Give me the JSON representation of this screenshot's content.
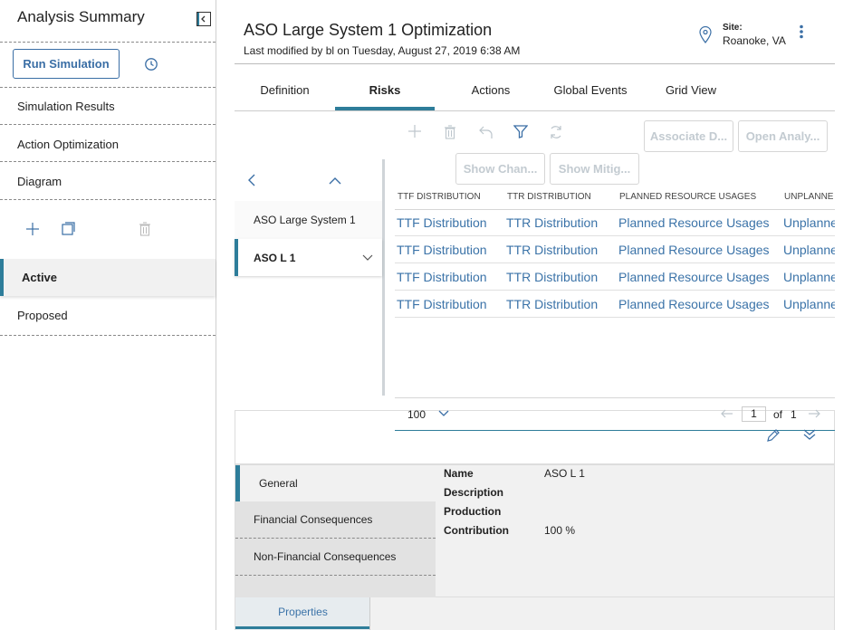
{
  "left_panel": {
    "title": "Analysis Summary",
    "run_button": "Run Simulation",
    "nav_items": [
      "Simulation Results",
      "Action Optimization",
      "Diagram"
    ],
    "scenarios": [
      "Active",
      "Proposed"
    ]
  },
  "header": {
    "title": "ASO Large System 1 Optimization",
    "modified": "Last modified by bl on Tuesday, August 27, 2019 6:38 AM",
    "site_label": "Site:",
    "site_value": "Roanoke, VA"
  },
  "tabs": [
    "Definition",
    "Risks",
    "Actions",
    "Global Events",
    "Grid View"
  ],
  "active_tab": "Risks",
  "toolbar": {
    "associate": "Associate D...",
    "open_analysis": "Open Analy...",
    "show_changes": "Show Chan...",
    "show_mitigation": "Show Mitig..."
  },
  "tree": {
    "items": [
      "ASO Large System 1",
      "ASO L 1"
    ]
  },
  "grid": {
    "columns": [
      "TTF DISTRIBUTION",
      "TTR DISTRIBUTION",
      "PLANNED RESOURCE USAGES",
      "UNPLANNE"
    ],
    "rows": [
      [
        "TTF Distribution",
        "TTR Distribution",
        "Planned Resource Usages",
        "Unplanne"
      ],
      [
        "TTF Distribution",
        "TTR Distribution",
        "Planned Resource Usages",
        "Unplanne"
      ],
      [
        "TTF Distribution",
        "TTR Distribution",
        "Planned Resource Usages",
        "Unplanne"
      ],
      [
        "TTF Distribution",
        "TTR Distribution",
        "Planned Resource Usages",
        "Unplanne"
      ]
    ],
    "page_size": "100",
    "page": "1",
    "of_label": "of",
    "total_pages": "1"
  },
  "details": {
    "sections": [
      "General",
      "Financial Consequences",
      "Non-Financial Consequences"
    ],
    "fields": [
      {
        "label": "Name",
        "value": "ASO L 1"
      },
      {
        "label": "Description",
        "value": ""
      },
      {
        "label": "Production",
        "value": ""
      },
      {
        "label": "Contribution",
        "value": "100 %"
      }
    ],
    "bottom_tab": "Properties"
  },
  "colors": {
    "accent": "#2e7d9a",
    "link": "#3b73a8",
    "button_blue": "#3a6ea5"
  }
}
